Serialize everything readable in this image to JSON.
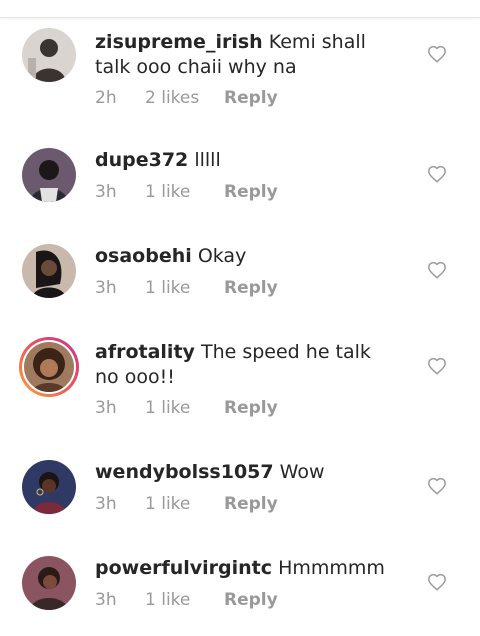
{
  "comments": [
    {
      "username": "zisupreme_irish",
      "text": "Kemi shall talk ooo chaii why na",
      "time": "2h",
      "likes": "2 likes",
      "reply": "Reply",
      "avatar": {
        "bg": "#d9d4d0",
        "fg": "#3a3330",
        "icon": "avatar-photo"
      }
    },
    {
      "username": "dupe372",
      "text": "lllll",
      "time": "3h",
      "likes": "1 like",
      "reply": "Reply",
      "avatar": {
        "bg": "#6b5a6e",
        "fg": "#1d1818",
        "icon": "avatar-photo"
      }
    },
    {
      "username": "osaobehi",
      "text": "Okay",
      "time": "3h",
      "likes": "1 like",
      "reply": "Reply",
      "avatar": {
        "bg": "#c9b9ad",
        "fg": "#1a1517",
        "icon": "avatar-photo"
      }
    },
    {
      "username": "afrotality",
      "text": "The speed he talk no ooo!!",
      "time": "3h",
      "likes": "1 like",
      "reply": "Reply",
      "avatar": {
        "bg": "#a07a5e",
        "fg": "#3a2418",
        "icon": "avatar-photo"
      }
    },
    {
      "username": "wendybolss1057",
      "text": "Wow",
      "time": "3h",
      "likes": "1 like",
      "reply": "Reply",
      "avatar": {
        "bg": "#2e3a64",
        "fg": "#5a3426",
        "icon": "avatar-photo"
      }
    },
    {
      "username": "powerfulvirgintc",
      "text": "Hmmmmm",
      "time": "3h",
      "likes": "1 like",
      "reply": "Reply",
      "avatar": {
        "bg": "#8a5560",
        "fg": "#2a1a18",
        "icon": "avatar-photo"
      }
    }
  ],
  "colors": {
    "text": "#262626",
    "meta": "#999999",
    "heart": "#9a9a9a",
    "story_ring_start": "#f7a63a",
    "story_ring_end": "#c8358f"
  },
  "icons": {
    "like": "heart-outline-icon"
  }
}
